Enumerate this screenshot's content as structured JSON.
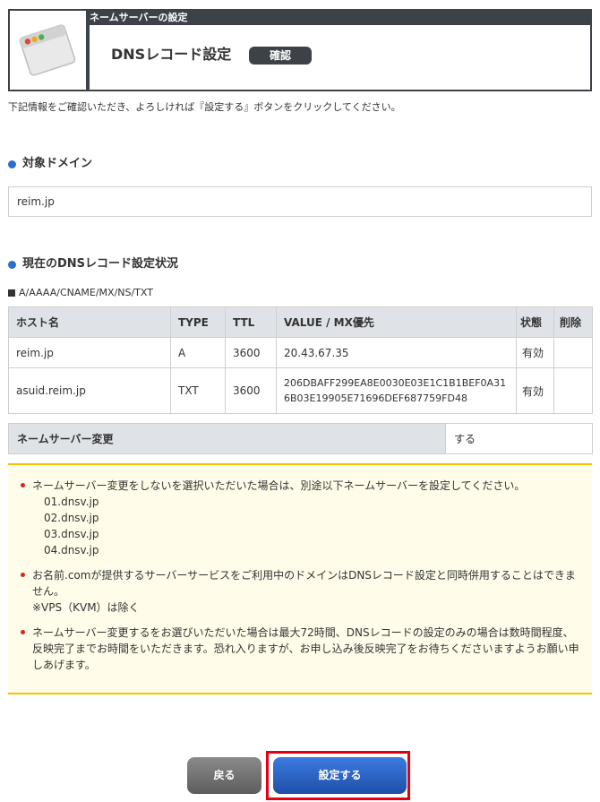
{
  "header": {
    "breadcrumb": "ネームサーバーの設定",
    "title": "DNSレコード設定",
    "badge": "確認"
  },
  "instruction": "下記情報をご確認いただき、よろしければ『設定する』ボタンをクリックしてください。",
  "domain_section": {
    "heading": "対象ドメイン",
    "value": "reim.jp"
  },
  "records_section": {
    "heading": "現在のDNSレコード設定状況",
    "types_label": "A/AAAA/CNAME/MX/NS/TXT",
    "columns": [
      "ホスト名",
      "TYPE",
      "TTL",
      "VALUE / MX優先",
      "状態",
      "削除"
    ],
    "rows": [
      {
        "host": "reim.jp",
        "type": "A",
        "ttl": "3600",
        "value": "20.43.67.35",
        "status": "有効",
        "delete": ""
      },
      {
        "host": "asuid.reim.jp",
        "type": "TXT",
        "ttl": "3600",
        "value": "206DBAFF299EA8E0030E03E1C1B1BEF0A316B03E19905E71696DEF687759FD48",
        "status": "有効",
        "delete": ""
      }
    ]
  },
  "nameserver_change": {
    "label": "ネームサーバー変更",
    "value": "する"
  },
  "notes": {
    "note1": "ネームサーバー変更をしないを選択いただいた場合は、別途以下ネームサーバーを設定してください。",
    "nameservers": [
      "01.dnsv.jp",
      "02.dnsv.jp",
      "03.dnsv.jp",
      "04.dnsv.jp"
    ],
    "note2": "お名前.comが提供するサーバーサービスをご利用中のドメインはDNSレコード設定と同時併用することはできません。",
    "note2_sub": "※VPS（KVM）は除く",
    "note3": "ネームサーバー変更するをお選びいただいた場合は最大72時間、DNSレコードの設定のみの場合は数時間程度、反映完了までお時間をいただきます。恐れ入りますが、お申し込み後反映完了をお待ちくださいますようお願い申しあげます。"
  },
  "buttons": {
    "back": "戻る",
    "submit": "設定する"
  },
  "colors": {
    "header_bg": "#3d4248",
    "accent_blue": "#2a6fcf",
    "note_border": "#f2c400",
    "highlight": "#e3000f"
  }
}
